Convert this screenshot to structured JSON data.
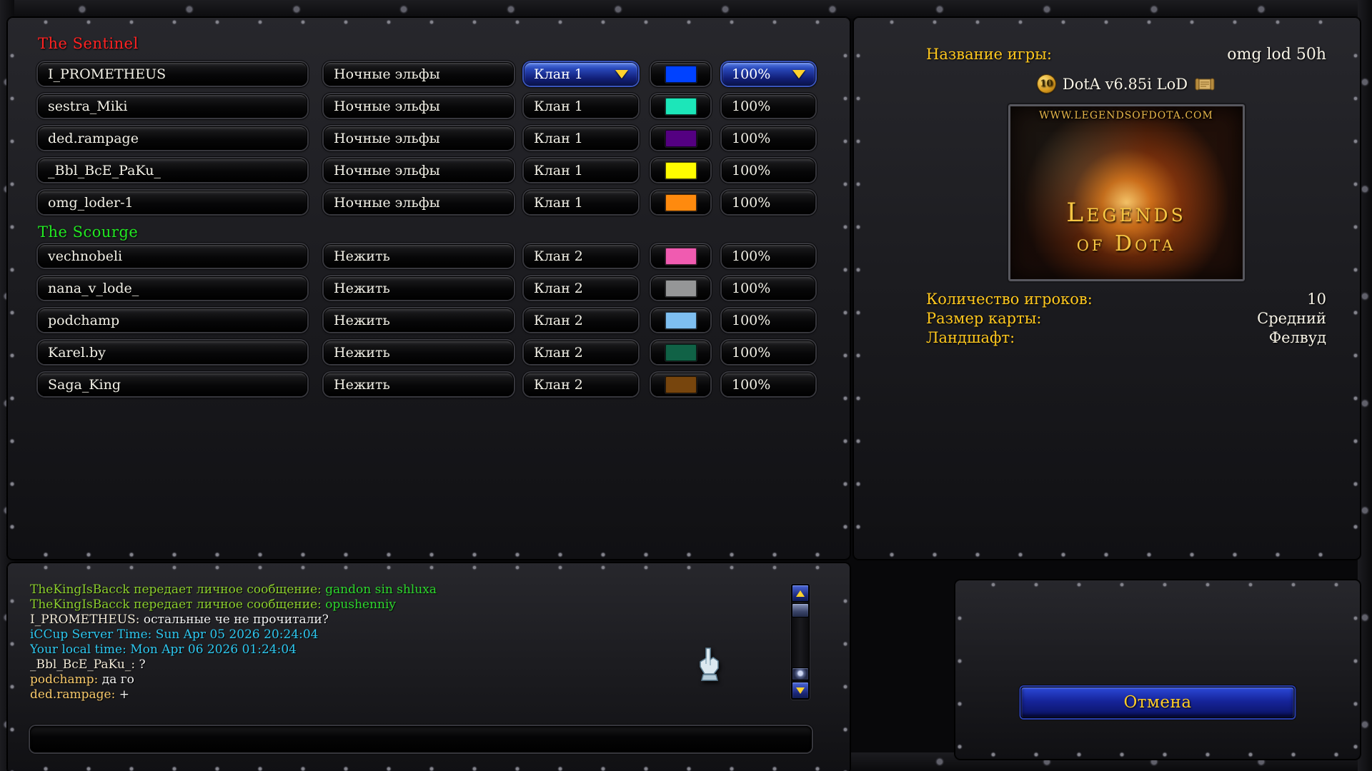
{
  "teams": [
    {
      "name": "The Sentinel",
      "color": "#ff2222",
      "players": [
        {
          "name": "I_PROMETHEUS",
          "race": "Ночные эльфы",
          "clan": "Клан 1",
          "color": "#0042ff",
          "handicap": "100%",
          "active": true
        },
        {
          "name": "sestra_Miki",
          "race": "Ночные эльфы",
          "clan": "Клан 1",
          "color": "#1ce6b9",
          "handicap": "100%",
          "active": false
        },
        {
          "name": "ded.rampage",
          "race": "Ночные эльфы",
          "clan": "Клан 1",
          "color": "#540081",
          "handicap": "100%",
          "active": false
        },
        {
          "name": "_Bbl_BcE_PaKu_",
          "race": "Ночные эльфы",
          "clan": "Клан 1",
          "color": "#fffc00",
          "handicap": "100%",
          "active": false
        },
        {
          "name": "omg_loder-1",
          "race": "Ночные эльфы",
          "clan": "Клан 1",
          "color": "#fe8a0e",
          "handicap": "100%",
          "active": false
        }
      ]
    },
    {
      "name": "The Scourge",
      "color": "#22e822",
      "players": [
        {
          "name": "vechnobeli",
          "race": "Нежить",
          "clan": "Клан 2",
          "color": "#f05bb0",
          "handicap": "100%",
          "active": false
        },
        {
          "name": "nana_v_lode_",
          "race": "Нежить",
          "clan": "Клан 2",
          "color": "#959697",
          "handicap": "100%",
          "active": false
        },
        {
          "name": "podchamp",
          "race": "Нежить",
          "clan": "Клан 2",
          "color": "#7ebff1",
          "handicap": "100%",
          "active": false
        },
        {
          "name": "Karel.by",
          "race": "Нежить",
          "clan": "Клан 2",
          "color": "#106246",
          "handicap": "100%",
          "active": false
        },
        {
          "name": "Saga_King",
          "race": "Нежить",
          "clan": "Клан 2",
          "color": "#77450d",
          "handicap": "100%",
          "active": false
        }
      ]
    }
  ],
  "game_info": {
    "name_label": "Название игры:",
    "name_value": "omg lod 50h",
    "map_slots_badge": "10",
    "map_title": "DotA v6.85i LoD",
    "map_preview": {
      "site": "www.LegendsOfDota.com",
      "logo_line1": "Legends",
      "logo_line2": "of Dota"
    },
    "players_label": "Количество игроков:",
    "players_value": "10",
    "size_label": "Размер карты:",
    "size_value": "Средний",
    "terrain_label": "Ландшафт:",
    "terrain_value": "Фелвуд"
  },
  "chat": {
    "lines": [
      {
        "segments": [
          {
            "text": "TheKingIsBacck передает личное сообщение: ",
            "color": "#8ccf2e"
          },
          {
            "text": "gandon sin shluxa",
            "color": "#2ed82e"
          }
        ]
      },
      {
        "segments": [
          {
            "text": "TheKingIsBacck передает личное сообщение: ",
            "color": "#8ccf2e"
          },
          {
            "text": "opushenniy",
            "color": "#2ed82e"
          }
        ]
      },
      {
        "segments": [
          {
            "text": "I_PROMETHEUS: ",
            "color": "#f2ead8"
          },
          {
            "text": "остальные че не прочитали?",
            "color": "#f2f2f2"
          }
        ]
      },
      {
        "segments": [
          {
            "text": "iCCup Server Time: Sun Apr 05 2026 20:24:04",
            "color": "#2ec8f0"
          }
        ]
      },
      {
        "segments": [
          {
            "text": "Your local time: Mon Apr 06 2026 01:24:04",
            "color": "#2ec8f0"
          }
        ]
      },
      {
        "segments": [
          {
            "text": "_Bbl_BcE_PaKu_: ",
            "color": "#f2ead8"
          },
          {
            "text": "?",
            "color": "#f2f2f2"
          }
        ]
      },
      {
        "segments": [
          {
            "text": "podchamp: ",
            "color": "#f7c96b"
          },
          {
            "text": "да го",
            "color": "#f2f2f2"
          }
        ]
      },
      {
        "segments": [
          {
            "text": "ded.rampage: ",
            "color": "#f7c96b"
          },
          {
            "text": "+",
            "color": "#f2f2f2"
          }
        ]
      }
    ],
    "input_value": ""
  },
  "buttons": {
    "cancel_label": "Отмена"
  },
  "colors": {
    "gold": "#ffc81e",
    "team_sentinel": "#ff2222",
    "team_scourge": "#22e822"
  }
}
